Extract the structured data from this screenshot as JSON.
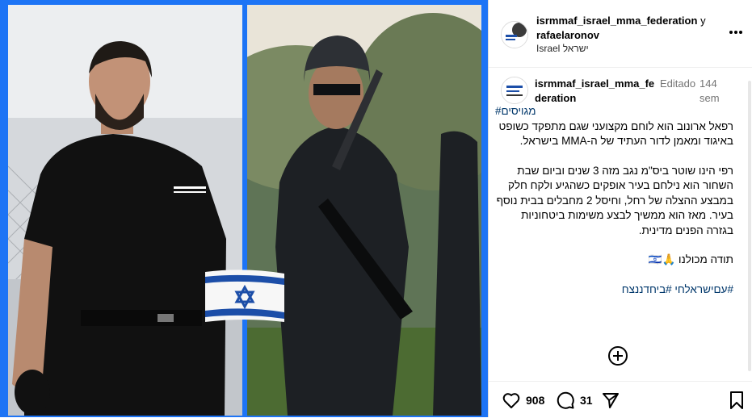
{
  "post": {
    "header": {
      "usernames": "isrmmaf_israel_mma_federation",
      "connector": "y",
      "second_user": "rafaelaronov",
      "location": "Israel ישראל",
      "more_icon": "more-horizontal-icon"
    },
    "caption": {
      "username": "isrmmaf_israel_mma_federation",
      "edited": "Editado",
      "time": "144 sem",
      "hashtag_top": "#מגויסים",
      "paragraph1": "רפאל ארונוב הוא לוחם מקצועני שגם מתפקד כשופט באיגוד ומאמן לדור העתיד של ה-MMA בישראל.",
      "paragraph2": "רפי הינו שוטר ביס\"מ נגב מזה 3 שנים וביום שבת השחור הוא נילחם בעיר אופקים כשהגיע ולקח חלק במבצע ההצלה של רחל, וחיסל 2 מחבלים בבית נוסף בעיר. מאז הוא ממשיך לבצע משימות ביטחוניות בגזרה הפנים מדינית.",
      "thanks": "תודה מכולנו 🙏🇮🇱",
      "hashtags_bottom": "#עםישראלחי #ביחדננצח"
    },
    "actions": {
      "likes": "908",
      "comments": "31",
      "like_icon": "heart-icon",
      "comment_icon": "comment-icon",
      "share_icon": "share-icon",
      "save_icon": "bookmark-icon",
      "add_icon": "plus-circle-icon"
    },
    "colors": {
      "border_blue": "#1d74f5",
      "hashtag": "#00376b",
      "muted": "#737373"
    }
  }
}
